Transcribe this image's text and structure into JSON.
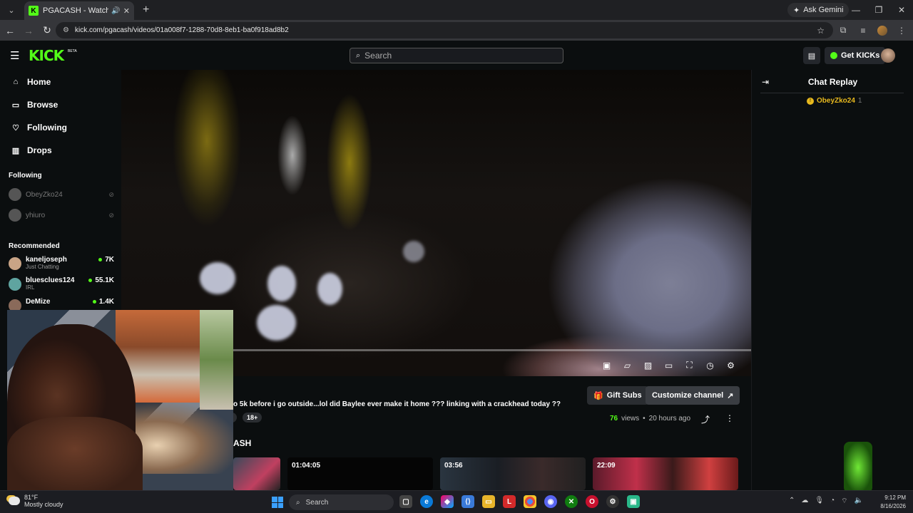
{
  "browser": {
    "tab_title": "PGACASH - Watch the VOD",
    "tab_favicon": "K",
    "new_tab": "+",
    "ask_gemini": "Ask Gemini",
    "url": "kick.com/pgacash/videos/01a008f7-1288-70d8-8eb1-ba0f918ad8b2"
  },
  "header": {
    "logo": "KICK",
    "beta": "BETA",
    "search_placeholder": "Search",
    "get_kicks": "Get KICKs"
  },
  "sidebar": {
    "nav": [
      {
        "label": "Home",
        "icon": "home-icon"
      },
      {
        "label": "Browse",
        "icon": "browse-icon"
      },
      {
        "label": "Following",
        "icon": "heart-icon"
      },
      {
        "label": "Drops",
        "icon": "drops-icon"
      }
    ],
    "following_heading": "Following",
    "following": [
      {
        "name": "ObeyZko24"
      },
      {
        "name": "yhiuro"
      }
    ],
    "recommended_heading": "Recommended",
    "recommended": [
      {
        "name": "kaneljoseph",
        "category": "Just Chatting",
        "viewers": "7K"
      },
      {
        "name": "bluesclues124",
        "category": "IRL",
        "viewers": "55.1K"
      },
      {
        "name": "DeMize",
        "category": "",
        "viewers": "1.4K"
      }
    ]
  },
  "video": {
    "progress": 0.1,
    "controls": [
      "pip-icon",
      "clip-icon",
      "theatre-icon",
      "captions-icon",
      "fullscreen-icon",
      "rewind-icon",
      "settings-icon"
    ]
  },
  "chat": {
    "title": "Chat Replay",
    "messages": [
      {
        "user": "ObeyZko24",
        "count": "1"
      }
    ]
  },
  "vod": {
    "title": "o 5k before i go outside...lol did Baylee ever make it home ??? linking with a crackhead today ??",
    "tag": "18+",
    "views_count": "76",
    "views_label": "views",
    "separator": "•",
    "age": "20 hours ago",
    "gift_subs": "Gift Subs",
    "customize": "Customize channel",
    "channel_fragment": "ASH"
  },
  "thumbnails": [
    {
      "duration": ""
    },
    {
      "duration": "01:04:05"
    },
    {
      "duration": "03:56"
    },
    {
      "duration": "22:09"
    }
  ],
  "taskbar": {
    "temp": "81°F",
    "condition": "Mostly cloudy",
    "search": "Search",
    "time": "9:12 PM",
    "date": "8/16/2026"
  },
  "colors": {
    "kick_green": "#53fc18",
    "bg": "#0b0e0f"
  }
}
